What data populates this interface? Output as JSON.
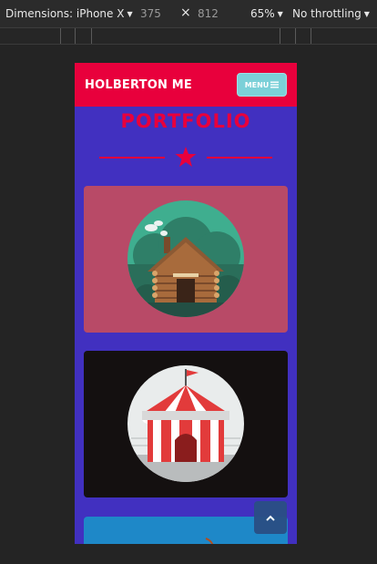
{
  "devtools": {
    "dimensions_label": "Dimensions: iPhone X",
    "width": "375",
    "times": "×",
    "height": "812",
    "zoom": "65%",
    "throttling": "No throttling"
  },
  "site": {
    "brand": "HOLBERTON ME",
    "menu_label": "MENU",
    "menu_icon": "hamburger-icon",
    "section_title": "PORTFOLIO",
    "divider_icon": "star-icon",
    "colors": {
      "navbar": "#e8003c",
      "background": "#4130c0",
      "menu_button": "#7bd0d8",
      "card_1": "#b84a67",
      "card_2": "#141010",
      "card_3": "#1e88c8"
    },
    "portfolio_items": [
      {
        "icon": "log-cabin-icon"
      },
      {
        "icon": "circus-tent-icon"
      },
      {
        "icon": "cake-icon"
      }
    ],
    "scroll_top_icon": "chevron-up-icon"
  }
}
